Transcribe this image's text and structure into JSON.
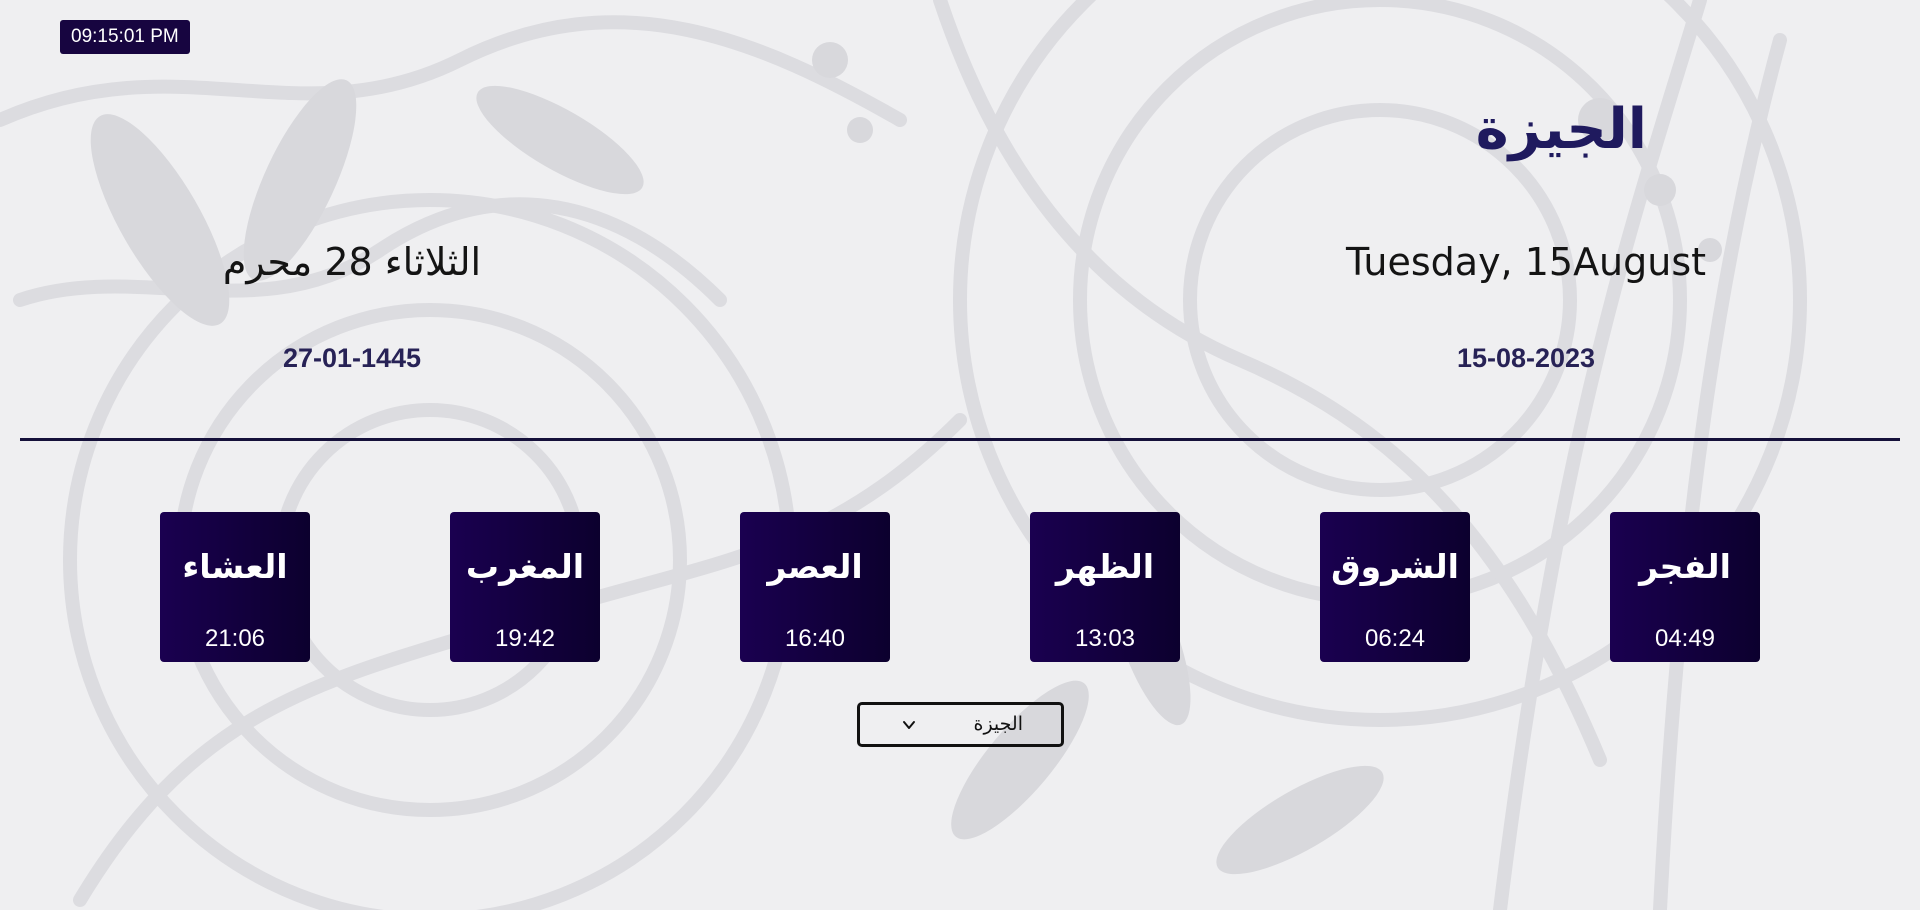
{
  "clock": {
    "time": "09:15:01 PM"
  },
  "location": {
    "city_title": "الجيزة"
  },
  "hijri": {
    "weekday_day_month": "الثلاثاء 28 محرم",
    "numeric": "27-01-1445"
  },
  "gregorian": {
    "weekday_day_month": "Tuesday, 15August",
    "numeric": "15-08-2023"
  },
  "prayers": [
    {
      "name": "العشاء",
      "time": "21:06"
    },
    {
      "name": "المغرب",
      "time": "19:42"
    },
    {
      "name": "العصر",
      "time": "16:40"
    },
    {
      "name": "الظهر",
      "time": "13:03"
    },
    {
      "name": "الشروق",
      "time": "06:24"
    },
    {
      "name": "الفجر",
      "time": "04:49"
    }
  ],
  "city_select": {
    "selected": "الجيزة",
    "icon": "chevron-down-icon"
  },
  "colors": {
    "accent": "#170540",
    "title": "#1f1a5e",
    "background": "#efeff1"
  }
}
